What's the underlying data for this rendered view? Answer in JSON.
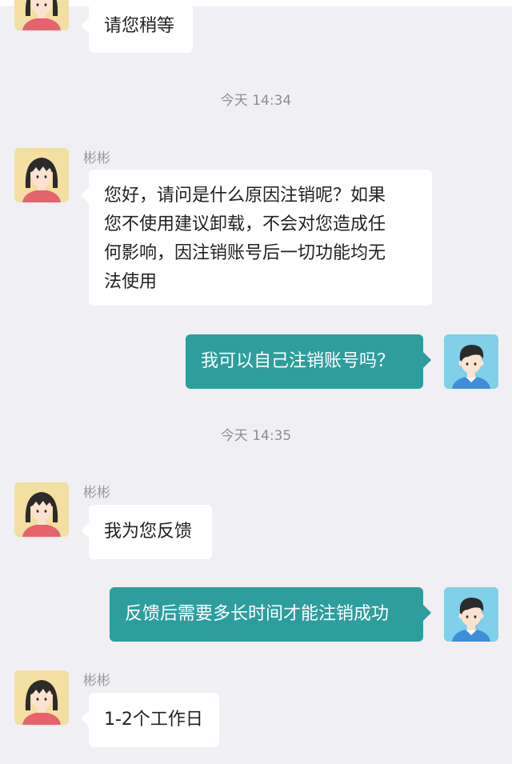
{
  "colors": {
    "background": "#efeff4",
    "incoming_bubble": "#ffffff",
    "outgoing_bubble": "#2e9e9c",
    "outgoing_text": "#ffffff",
    "timestamp_text": "#8e8e93",
    "girl_avatar_bg": "#f2dfa1",
    "boy_avatar_bg": "#7fd0e8"
  },
  "timestamps": [
    "今天 14:34",
    "今天 14:35"
  ],
  "sender_name": "彬彬",
  "messages": [
    {
      "from": "agent",
      "text": "请您稍等"
    },
    {
      "from": "agent",
      "name": "彬彬",
      "lines": [
        "您好，请问是什么原因注销呢？如果",
        "您不使用建议卸载，不会对您造成任",
        "何影响，因注销账号后一切功能均无",
        "法使用"
      ]
    },
    {
      "from": "user",
      "text": "我可以自己注销账号吗？"
    },
    {
      "from": "agent",
      "name": "彬彬",
      "text": "我为您反馈"
    },
    {
      "from": "user",
      "text": "反馈后需要多长时间才能注销成功"
    },
    {
      "from": "agent",
      "name": "彬彬",
      "text": "1-2个工作日"
    }
  ],
  "icons": {
    "agent_avatar": "girl-avatar-icon",
    "user_avatar": "boy-avatar-icon"
  }
}
